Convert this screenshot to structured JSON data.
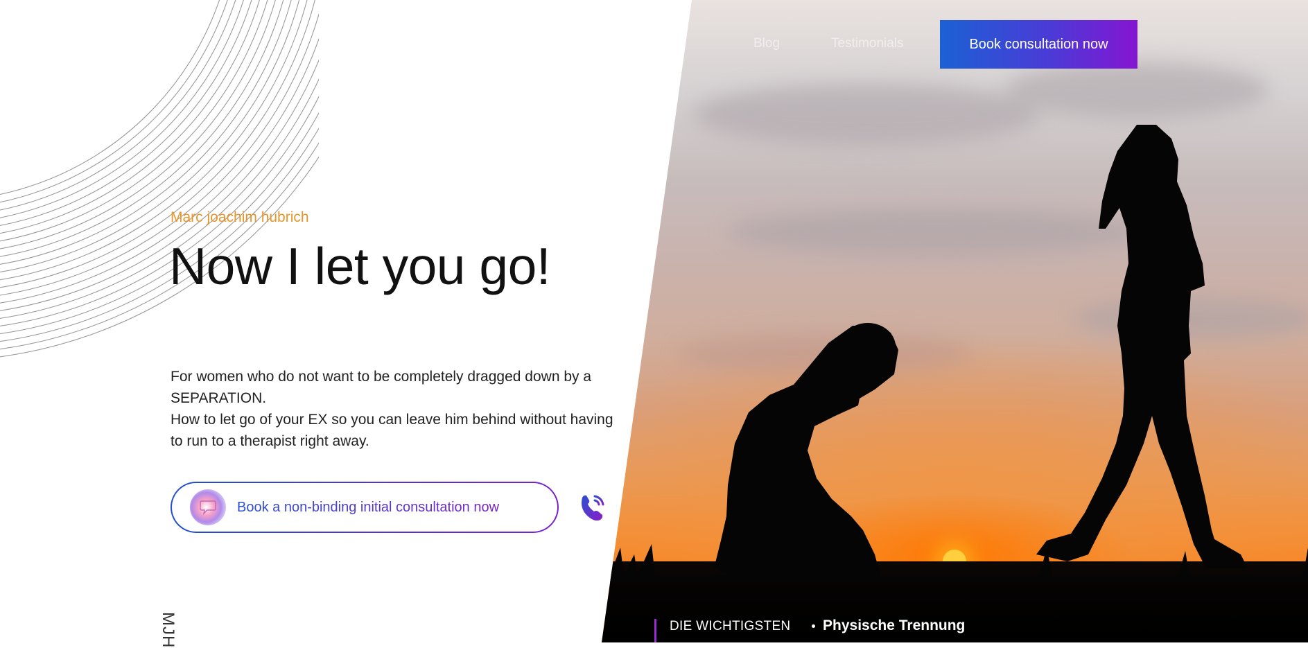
{
  "nav": {
    "links": [
      "Blog",
      "Testimonials"
    ],
    "cta_label": "Book consultation now"
  },
  "hero": {
    "eyebrow": "Marc joachim hubrich",
    "headline": "Now I let you go!",
    "lead_line1": "For women who do not want to be completely dragged down by a SEPARATION.",
    "lead_line2": "How to let go of your EX so you can leave him behind without having to run to a therapist right away.",
    "cta_label": "Book a non-binding initial consultation now",
    "vertical_logo": "MJH"
  },
  "ticker": {
    "label": "DIE WICHTIGSTEN",
    "item": "Physische Trennung"
  },
  "icons": {
    "cta_icon": "chat-bubble-icon",
    "phone": "phone-call-icon"
  },
  "colors": {
    "accent_orange": "#e8962a",
    "gradient_start": "#1b61d4",
    "gradient_end": "#8515d2"
  }
}
